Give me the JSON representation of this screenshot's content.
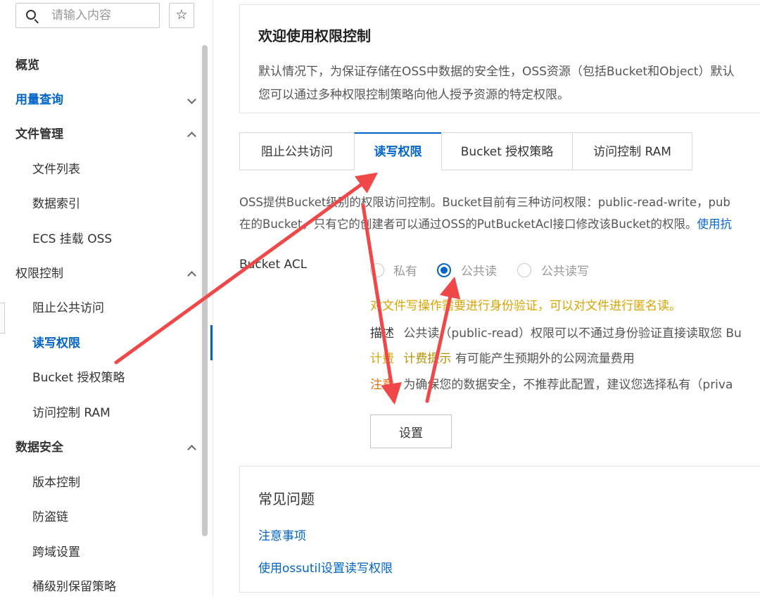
{
  "search": {
    "placeholder": "请输入内容"
  },
  "star_icon": "☆",
  "sidebar": {
    "overview": "概览",
    "usage": "用量查询",
    "file_mgmt": "文件管理",
    "file_list": "文件列表",
    "data_index": "数据索引",
    "ecs_mount": "ECS 挂载 OSS",
    "permission": "权限控制",
    "block_public": "阻止公共访问",
    "rw_permission": "读写权限",
    "bucket_policy": "Bucket 授权策略",
    "ram_access": "访问控制 RAM",
    "data_security": "数据安全",
    "versioning": "版本控制",
    "hotlink": "防盗链",
    "cors": "跨域设置",
    "retention": "桶级别保留策略"
  },
  "welcome": {
    "title": "欢迎使用权限控制",
    "line1": "默认情况下，为保证存储在OSS中数据的安全性，OSS资源（包括Bucket和Object）默认",
    "line2": "您可以通过多种权限控制策略向他人授予资源的特定权限。"
  },
  "tabs": [
    "阻止公共访问",
    "读写权限",
    "Bucket 授权策略",
    "访问控制 RAM"
  ],
  "intro": {
    "line1": "OSS提供Bucket级别的权限访问控制。Bucket目前有三种访问权限：public-read-write，pub",
    "line2": "在的Bucket，只有它的创建者可以通过OSS的PutBucketAcl接口修改该Bucket的权限。",
    "link": "使用抗"
  },
  "acl": {
    "label": "Bucket ACL",
    "options": [
      "私有",
      "公共读",
      "公共读写"
    ],
    "selected": "公共读"
  },
  "info": {
    "warning": "对文件写操作需要进行身份验证，可以对文件进行匿名读。",
    "desc_label": "描述",
    "desc_text": "公共读（public-read）权限可以不通过身份验证直接读取您 Bu",
    "billing_label": "计费",
    "billing_hint": "计费提示",
    "billing_text": "有可能产生预期外的公网流量费用",
    "notice_label": "注意",
    "notice_text": "为确保您的数据安全，不推荐此配置，建议您选择私有（priva"
  },
  "set_button": "设置",
  "faq": {
    "title": "常见问题",
    "link1": "注意事项",
    "link2": "使用ossutil设置读写权限"
  },
  "colors": {
    "accent": "#0064c8",
    "annotation_arrow": "#f04848"
  }
}
